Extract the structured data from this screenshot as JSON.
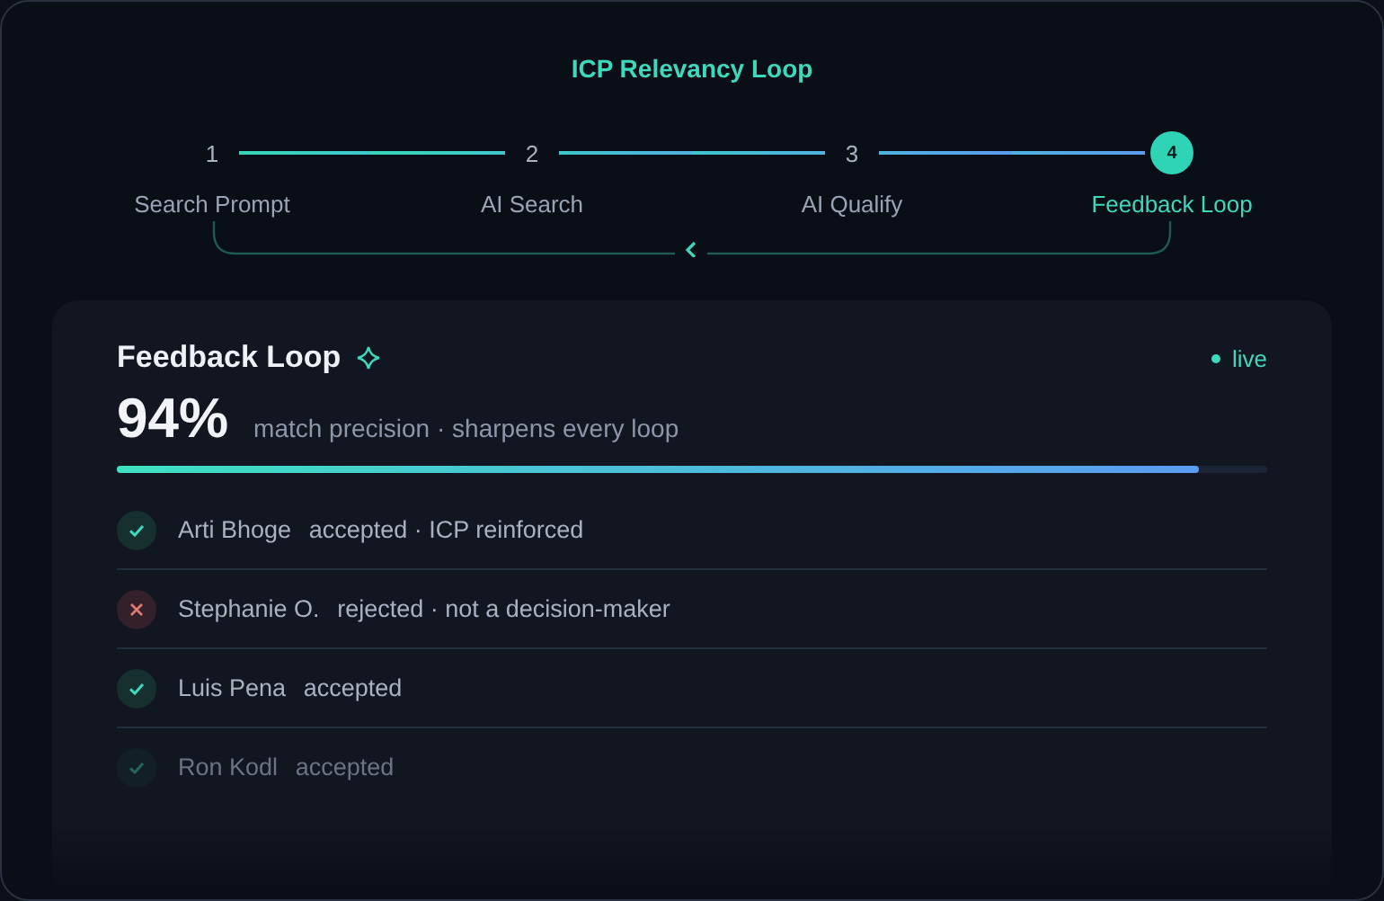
{
  "title": "ICP Relevancy Loop",
  "steps": [
    {
      "number": "1",
      "label": "Search Prompt",
      "selected": false
    },
    {
      "number": "2",
      "label": "AI Search",
      "selected": false
    },
    {
      "number": "3",
      "label": "AI Qualify",
      "selected": false
    },
    {
      "number": "4",
      "label": "Feedback Loop",
      "selected": true
    }
  ],
  "card": {
    "title": "Feedback Loop",
    "status": "live",
    "metric": "94%",
    "metric_caption": "match precision · sharpens every loop",
    "level": 0.94,
    "rows": [
      {
        "kind": "accepted",
        "name": "Arti Bhoge",
        "note": "accepted · ICP reinforced",
        "dimmed": false
      },
      {
        "kind": "rejected",
        "name": "Stephanie O.",
        "note": "rejected · not a decision-maker",
        "dimmed": false
      },
      {
        "kind": "accepted",
        "name": "Luis Pena",
        "note": "accepted",
        "dimmed": false
      },
      {
        "kind": "accepted",
        "name": "Ron Kodl",
        "note": "accepted",
        "dimmed": true
      }
    ]
  }
}
